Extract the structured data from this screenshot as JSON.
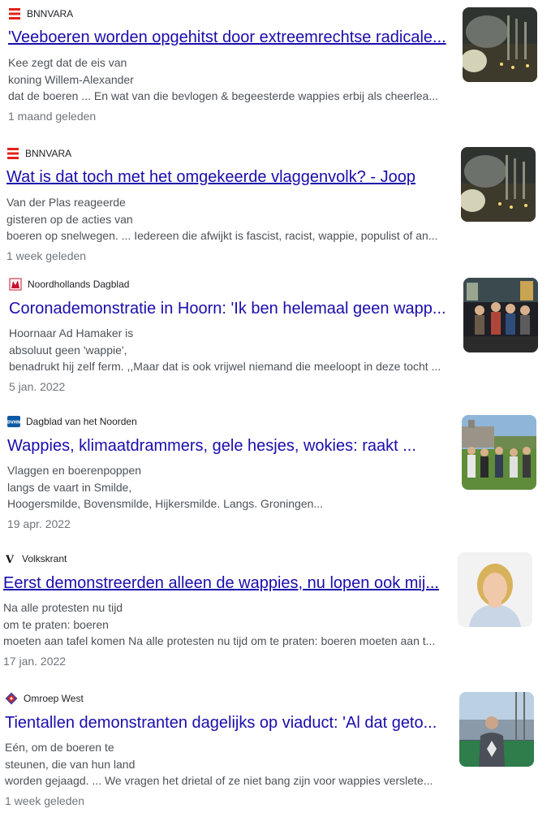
{
  "results": [
    {
      "source": "BNNVARA",
      "source_icon": "bnnvara-logo-icon",
      "title": "'Veeboeren worden opgehitst door extreemrechtse radicale...",
      "snippet": [
        "Kee zegt dat de eis van",
        "koning Willem-Alexander",
        "dat de boeren ... En wat van die bevlogen & begeesterde wappies erbij als cheerlea..."
      ],
      "date": "1 maand geleden",
      "image": "factory-night-thumbnail"
    },
    {
      "source": "BNNVARA",
      "source_icon": "bnnvara-logo-icon",
      "title": "Wat is dat toch met het omgekeerde vlaggenvolk? - Joop",
      "snippet": [
        "Van der Plas reageerde",
        "gisteren op de acties van",
        "boeren op snelwegen. ... Iedereen die afwijkt is fascist, racist, wappie, populist of an..."
      ],
      "date": "1 week geleden",
      "image": "factory-night-thumbnail"
    },
    {
      "source": "Noordhollands Dagblad",
      "source_icon": "noordhollands-dagblad-logo-icon",
      "title": "Coronademonstratie in Hoorn: 'Ik ben helemaal geen wapp...",
      "snippet": [
        "Hoornaar Ad Hamaker is",
        "absoluut geen 'wappie',",
        "benadrukt hij zelf ferm. ,,Maar dat is ook vrijwel niemand die meeloopt in deze tocht ..."
      ],
      "date": "5 jan. 2022",
      "image": "street-demonstration-thumbnail"
    },
    {
      "source": "Dagblad van het Noorden",
      "source_icon": "dvhn-logo-icon",
      "title": "Wappies, klimaatdrammers, gele hesjes, wokies: raakt ...",
      "snippet": [
        "Vlaggen en boerenpoppen",
        "langs de vaart in Smilde,",
        "Hoogersmilde, Bovensmilde, Hijkersmilde. Langs. Groningen..."
      ],
      "date": "19 apr. 2022",
      "image": "group-outdoors-thumbnail"
    },
    {
      "source": "Volkskrant",
      "source_icon": "volkskrant-logo-icon",
      "title": "Eerst demonstreerden alleen de wappies, nu lopen ook mij...",
      "snippet": [
        "Na alle protesten nu tijd",
        "om te praten: boeren",
        "moeten aan tafel komen Na alle protesten nu tijd om te praten: boeren moeten aan t..."
      ],
      "date": "17 jan. 2022",
      "image": "columnist-portrait-thumbnail"
    },
    {
      "source": "Omroep West",
      "source_icon": "omroep-west-logo-icon",
      "title": "Tientallen demonstranten dagelijks op viaduct: 'Al dat geto...",
      "snippet": [
        "Eén, om de boeren te",
        "steunen, die van hun land",
        "worden gejaagd. ... We vragen het drietal of ze niet bang zijn voor wappies verslete..."
      ],
      "date": "1 week geleden",
      "image": "viaduct-protester-thumbnail"
    }
  ],
  "colors": {
    "link": "#1a0dab",
    "snippet": "#4d5156",
    "date": "#70757a",
    "bnnvara": "#e2231a"
  }
}
